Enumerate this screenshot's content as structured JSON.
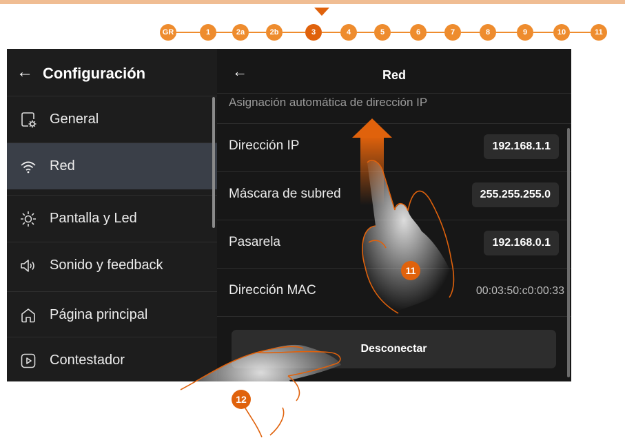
{
  "steps": {
    "items": [
      "GR",
      "1",
      "2a",
      "2b",
      "3",
      "4",
      "5",
      "6",
      "7",
      "8",
      "9",
      "10",
      "11"
    ],
    "active": "3"
  },
  "left_panel": {
    "title": "Configuración",
    "items": [
      {
        "label": "General",
        "icon": "settings-gear-icon"
      },
      {
        "label": "Red",
        "icon": "wifi-icon"
      },
      {
        "label": "Pantalla y Led",
        "icon": "sun-icon"
      },
      {
        "label": "Sonido y feedback",
        "icon": "speaker-icon"
      },
      {
        "label": "Página principal",
        "icon": "home-icon"
      },
      {
        "label": "Contestador",
        "icon": "play-icon"
      }
    ],
    "selected": "Red"
  },
  "right_panel": {
    "title": "Red",
    "auto_ip_label": "Asignación automática de dirección IP",
    "ip_label": "Dirección IP",
    "ip_value": "192.168.1.1",
    "mask_label": "Máscara de subred",
    "mask_value": "255.255.255.0",
    "gateway_label": "Pasarela",
    "gateway_value": "192.168.0.1",
    "mac_label": "Dirección MAC",
    "mac_value": "00:03:50:c0:00:33",
    "disconnect_label": "Desconectar"
  },
  "callouts": {
    "scroll_step": "11",
    "disconnect_step": "12"
  },
  "colors": {
    "accent": "#ee8c2e",
    "accent_dark": "#e0620c",
    "panel_bg": "#171717",
    "selected_bg": "#3a3f48"
  }
}
